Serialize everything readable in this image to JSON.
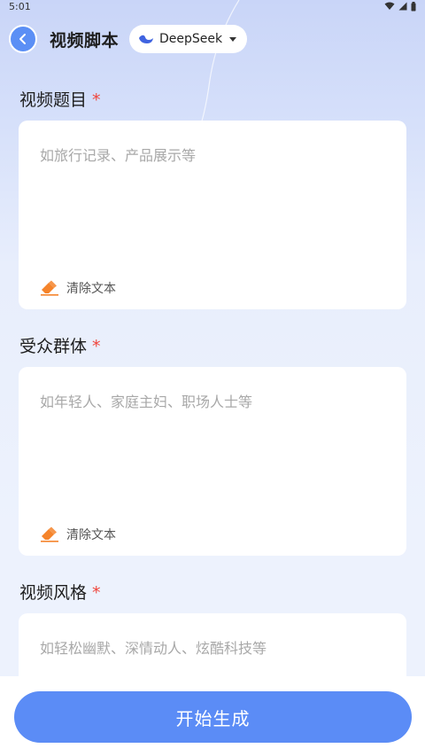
{
  "status_bar": {
    "time": "5:01"
  },
  "header": {
    "title": "视频脚本",
    "model_label": "DeepSeek"
  },
  "fields": [
    {
      "label": "视频题目",
      "required_mark": "*",
      "placeholder": "如旅行记录、产品展示等",
      "clear_label": "清除文本"
    },
    {
      "label": "受众群体",
      "required_mark": "*",
      "placeholder": "如年轻人、家庭主妇、职场人士等",
      "clear_label": "清除文本"
    },
    {
      "label": "视频风格",
      "required_mark": "*",
      "placeholder": "如轻松幽默、深情动人、炫酷科技等"
    }
  ],
  "start_button": "开始生成",
  "colors": {
    "accent": "#5b8cf6",
    "required": "#f0453c",
    "eraser": "#f5842b"
  },
  "icons": {
    "back": "chevron-left-icon",
    "model": "whale-icon",
    "clear": "eraser-icon"
  }
}
